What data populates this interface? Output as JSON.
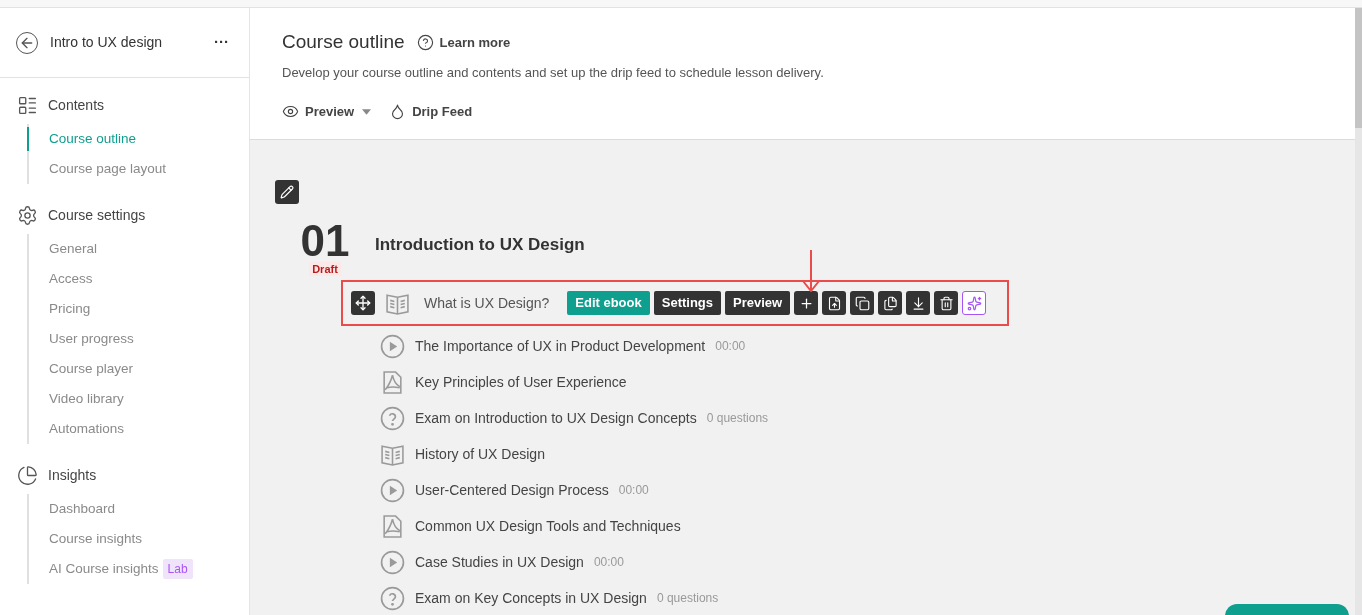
{
  "course": {
    "title": "Intro to UX design",
    "more": "···"
  },
  "sidebar": {
    "groups": [
      {
        "kind": "contents",
        "title": "Contents",
        "items": [
          {
            "label": "Course outline",
            "selected": true
          },
          {
            "label": "Course page layout",
            "selected": false
          }
        ]
      },
      {
        "kind": "settings",
        "title": "Course settings",
        "items": [
          {
            "label": "General",
            "selected": false
          },
          {
            "label": "Access",
            "selected": false
          },
          {
            "label": "Pricing",
            "selected": false
          },
          {
            "label": "User progress",
            "selected": false
          },
          {
            "label": "Course player",
            "selected": false
          },
          {
            "label": "Video library",
            "selected": false
          },
          {
            "label": "Automations",
            "selected": false
          }
        ]
      },
      {
        "kind": "insights",
        "title": "Insights",
        "items": [
          {
            "label": "Dashboard",
            "selected": false
          },
          {
            "label": "Course insights",
            "selected": false
          },
          {
            "label": "AI Course insights",
            "selected": false,
            "badge": "Lab"
          }
        ]
      }
    ]
  },
  "header": {
    "title": "Course outline",
    "learn_more": "Learn more",
    "description": "Develop your course outline and contents and set up the drip feed to schedule lesson delivery.",
    "actions": [
      {
        "kind": "preview",
        "label": "Preview"
      },
      {
        "kind": "drip",
        "label": "Drip Feed"
      }
    ]
  },
  "chapter": {
    "number": "01",
    "status": "Draft",
    "title": "Introduction to UX Design",
    "active_lesson": {
      "kind": "ebook",
      "title": "What is UX Design?",
      "buttons": [
        {
          "kind": "primary",
          "label": "Edit ebook"
        },
        {
          "kind": "dark",
          "label": "Settings"
        },
        {
          "kind": "dark",
          "label": "Preview"
        }
      ]
    },
    "lessons": [
      {
        "kind": "video",
        "title": "The Importance of UX in Product Development",
        "meta": "00:00"
      },
      {
        "kind": "pdf",
        "title": "Key Principles of User Experience"
      },
      {
        "kind": "quiz",
        "title": "Exam on Introduction to UX Design Concepts",
        "meta": "0 questions"
      },
      {
        "kind": "ebook",
        "title": "History of UX Design"
      },
      {
        "kind": "video",
        "title": "User-Centered Design Process",
        "meta": "00:00"
      },
      {
        "kind": "pdf",
        "title": "Common UX Design Tools and Techniques"
      },
      {
        "kind": "video",
        "title": "Case Studies in UX Design",
        "meta": "00:00"
      },
      {
        "kind": "quiz",
        "title": "Exam on Key Concepts in UX Design",
        "meta": "0 questions"
      }
    ]
  }
}
